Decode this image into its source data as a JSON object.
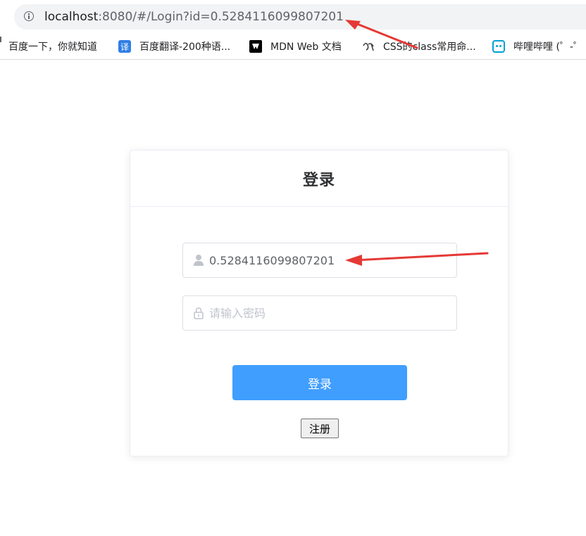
{
  "browser": {
    "url_host": "localhost",
    "url_rest": ":8080/#/Login?id=0.5284116099807201"
  },
  "bookmarks": [
    {
      "label": "百度一下，你就知道",
      "icon": "baidu-icon"
    },
    {
      "label": "百度翻译-200种语...",
      "icon": "translate-icon",
      "icon_text": "译"
    },
    {
      "label": "MDN Web 文档",
      "icon": "mdn-icon"
    },
    {
      "label": "CSS的class常用命...",
      "icon": "css-class-icon"
    },
    {
      "label": "哔哩哔哩 (゜-゜",
      "icon": "bilibili-icon"
    }
  ],
  "login": {
    "title": "登录",
    "username_value": "0.5284116099807201",
    "password_placeholder": "请输入密码",
    "submit_label": "登录",
    "register_label": "注册"
  },
  "colors": {
    "primary": "#409eff",
    "annotation_arrow": "#e53935"
  }
}
